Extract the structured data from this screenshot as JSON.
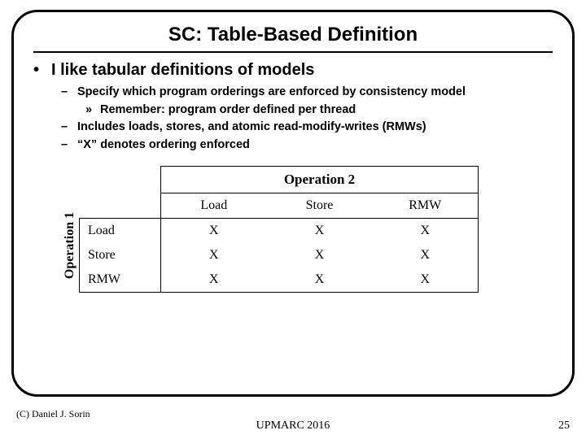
{
  "title": "SC: Table-Based Definition",
  "bullets": {
    "l1": "I like tabular definitions of models",
    "l2a": "Specify which program orderings are enforced by consistency model",
    "l3a": "Remember: program order defined per thread",
    "l2b": "Includes loads, stores, and atomic read-modify-writes (RMWs)",
    "l2c": "“X” denotes ordering enforced"
  },
  "table": {
    "op1_label": "Operation 1",
    "op2_label": "Operation 2",
    "cols": [
      "Load",
      "Store",
      "RMW"
    ],
    "rows": [
      "Load",
      "Store",
      "RMW"
    ],
    "cells": [
      [
        "X",
        "X",
        "X"
      ],
      [
        "X",
        "X",
        "X"
      ],
      [
        "X",
        "X",
        "X"
      ]
    ]
  },
  "footer": {
    "copyright": "(C) Daniel J. Sorin",
    "conference": "UPMARC 2016",
    "page": "25"
  },
  "chart_data": {
    "type": "table",
    "title": "SC ordering table",
    "rows": [
      "Load",
      "Store",
      "RMW"
    ],
    "columns": [
      "Load",
      "Store",
      "RMW"
    ],
    "values": [
      [
        "X",
        "X",
        "X"
      ],
      [
        "X",
        "X",
        "X"
      ],
      [
        "X",
        "X",
        "X"
      ]
    ]
  }
}
